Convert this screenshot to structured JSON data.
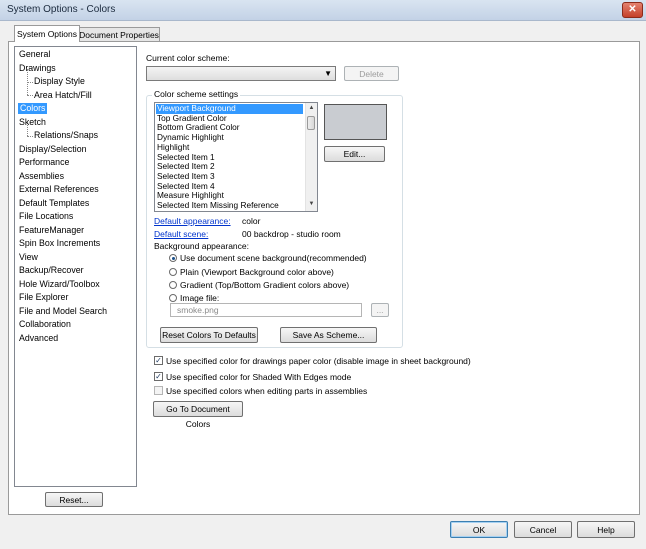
{
  "window": {
    "title": "System Options - Colors",
    "close_glyph": "✕"
  },
  "tabs": [
    {
      "label": "System Options",
      "active": true
    },
    {
      "label": "Document Properties",
      "active": false
    }
  ],
  "tree": {
    "items": [
      "General",
      "Drawings",
      "Display Style",
      "Area Hatch/Fill",
      "Colors",
      "Sketch",
      "Relations/Snaps",
      "Display/Selection",
      "Performance",
      "Assemblies",
      "External References",
      "Default Templates",
      "File Locations",
      "FeatureManager",
      "Spin Box Increments",
      "View",
      "Backup/Recover",
      "Hole Wizard/Toolbox",
      "File Explorer",
      "File and Model Search",
      "Collaboration",
      "Advanced"
    ],
    "selected": "Colors",
    "reset_label": "Reset..."
  },
  "scheme": {
    "label": "Current color scheme:",
    "value": "",
    "delete_label": "Delete"
  },
  "settings": {
    "group_title": "Color scheme settings",
    "items": [
      "Viewport Background",
      "Top Gradient Color",
      "Bottom Gradient Color",
      "Dynamic Highlight",
      "Highlight",
      "Selected Item 1",
      "Selected Item 2",
      "Selected Item 3",
      "Selected Item 4",
      "Measure Highlight",
      "Selected Item Missing Reference"
    ],
    "selected": "Viewport Background",
    "swatch_color": "#c9ccd1",
    "edit_label": "Edit...",
    "default_appearance_label": "Default appearance:",
    "default_appearance_value": "color",
    "default_scene_label": "Default scene:",
    "default_scene_value": "00 backdrop - studio room",
    "background_label": "Background appearance:",
    "radios": [
      {
        "label": "Use document scene background(recommended)",
        "checked": true
      },
      {
        "label": "Plain (Viewport Background color above)",
        "checked": false
      },
      {
        "label": "Gradient (Top/Bottom Gradient colors above)",
        "checked": false
      },
      {
        "label": "Image file:",
        "checked": false
      }
    ],
    "image_file_value": "smoke.png",
    "browse_label": "...",
    "reset_colors_label": "Reset Colors To Defaults",
    "save_scheme_label": "Save As Scheme..."
  },
  "checks": [
    {
      "label": "Use specified color for drawings paper color (disable image in sheet background)",
      "checked": true,
      "enabled": true
    },
    {
      "label": "Use specified color for Shaded With Edges mode",
      "checked": true,
      "enabled": true
    },
    {
      "label": "Use specified colors when editing parts in assemblies",
      "checked": false,
      "enabled": false
    }
  ],
  "go_to_doc_colors_label": "Go To Document Colors",
  "footer": {
    "ok_label": "OK",
    "cancel_label": "Cancel",
    "help_label": "Help"
  }
}
